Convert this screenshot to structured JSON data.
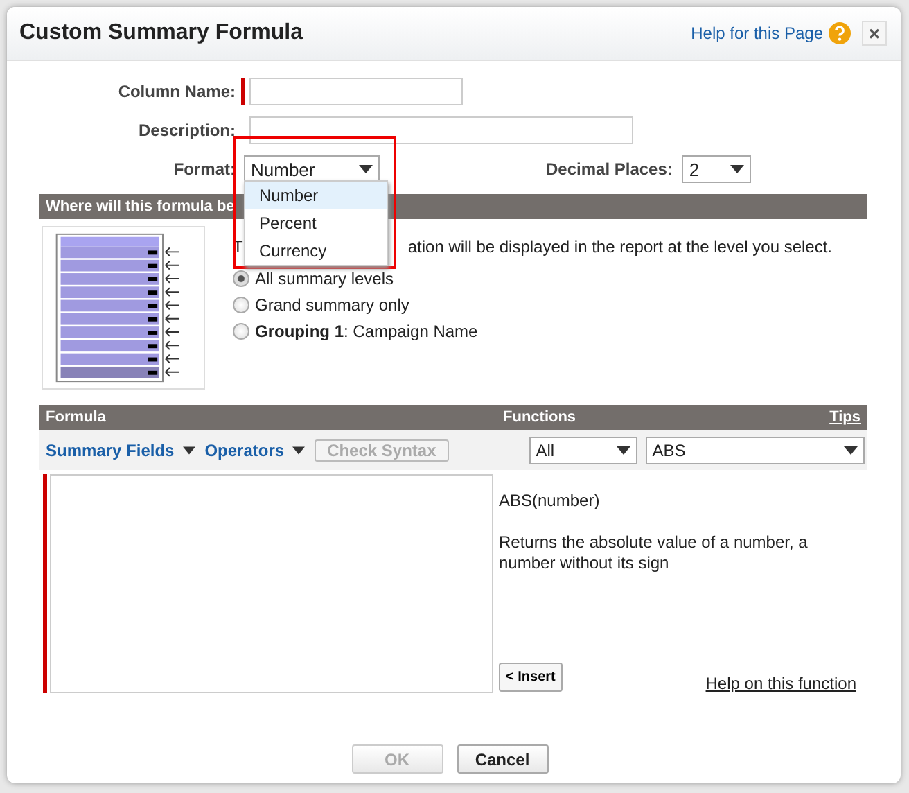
{
  "dialog": {
    "title": "Custom Summary Formula",
    "help_link": "Help for this Page",
    "close": "×"
  },
  "fields": [
    {
      "label": "Column Name:",
      "required": true
    },
    {
      "label": "Description:",
      "required": false
    }
  ],
  "format": {
    "label": "Format:",
    "value": "Number",
    "options": [
      {
        "label": "Number",
        "selected": true
      },
      {
        "label": "Percent",
        "selected": false
      },
      {
        "label": "Currency",
        "selected": false
      }
    ]
  },
  "decimal_places": {
    "label": "Decimal Places:",
    "value": "2"
  },
  "placement": {
    "header": "Where will this formula be",
    "sentence_start": "T",
    "sentence_end": "ation will be displayed in the report at the level you select.",
    "options": [
      {
        "label": "All summary levels",
        "selected": true
      },
      {
        "label": "Grand summary only",
        "selected": false
      },
      {
        "label": "**Grouping 1**: Campaign Name",
        "selected": false
      }
    ]
  },
  "formula": {
    "header": "Formula",
    "toolbar": [
      {
        "label": "Summary Fields",
        "kind": "menu"
      },
      {
        "label": "Operators",
        "kind": "menu"
      },
      {
        "label": "Check Syntax",
        "kind": "button",
        "disabled": true
      }
    ]
  },
  "functions": {
    "header": "Functions",
    "tips": "Tips",
    "category": "All",
    "function": "ABS",
    "signature": "ABS(number)",
    "description": "Returns the absolute value of a number, a number without its sign",
    "insert": "< Insert",
    "help": "Help on this function"
  },
  "buttons": [
    {
      "label": "OK",
      "disabled": true
    },
    {
      "label": "Cancel",
      "disabled": false
    }
  ]
}
